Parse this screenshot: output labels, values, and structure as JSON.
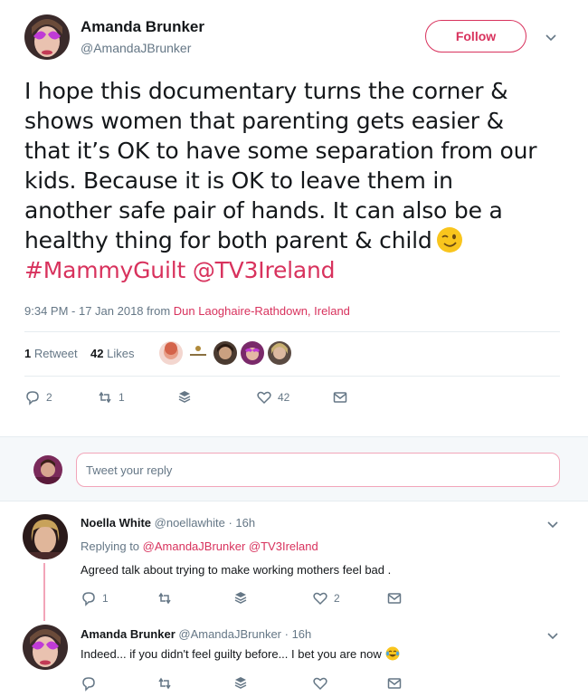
{
  "tweet": {
    "author_name": "Amanda Brunker",
    "author_handle": "@AmandaJBrunker",
    "follow_label": "Follow",
    "text_lines": [
      "I hope this documentary turns the corner &",
      "shows women that parenting gets easier &",
      "that it’s OK to have some separation from our",
      "kids. Because it is OK to leave them in",
      "another safe pair of hands. It can also be a",
      "healthy thing for both parent & child"
    ],
    "hashtag": "#MammyGuilt",
    "mention": "@TV3Ireland",
    "timestamp": "9:34 PM - 17 Jan 2018 from",
    "location": "Dun Laoghaire-Rathdown, Ireland",
    "retweet_count": "1",
    "retweet_label": "Retweet",
    "like_count": "42",
    "like_label": "Likes",
    "actions": {
      "reply_count": "2",
      "retweet_count": "1",
      "like_count": "42"
    }
  },
  "reply_box": {
    "placeholder": "Tweet your reply"
  },
  "replies": [
    {
      "name": "Noella White",
      "handle_time": "@noellawhite · 16h",
      "replying_prefix": "Replying to",
      "replying_to": "@AmandaJBrunker @TV3Ireland",
      "text": "Agreed talk about trying to make working mothers feel bad .",
      "reply_count": "1",
      "retweet_count": "",
      "like_count": "2"
    },
    {
      "name": "Amanda Brunker",
      "handle_time": "@AmandaJBrunker · 16h",
      "text": "Indeed... if you didn't feel guilty before... I bet you are now",
      "reply_count": "",
      "retweet_count": "",
      "like_count": ""
    }
  ],
  "colors": {
    "accent": "#d8325d",
    "muted": "#657786",
    "text": "#14171a",
    "divider": "#e6ecf0"
  },
  "icons": [
    "chevron-down-icon",
    "reply-icon",
    "retweet-icon",
    "dm-stack-icon",
    "heart-icon",
    "envelope-icon",
    "winking-face-emoji",
    "tears-of-joy-emoji"
  ]
}
